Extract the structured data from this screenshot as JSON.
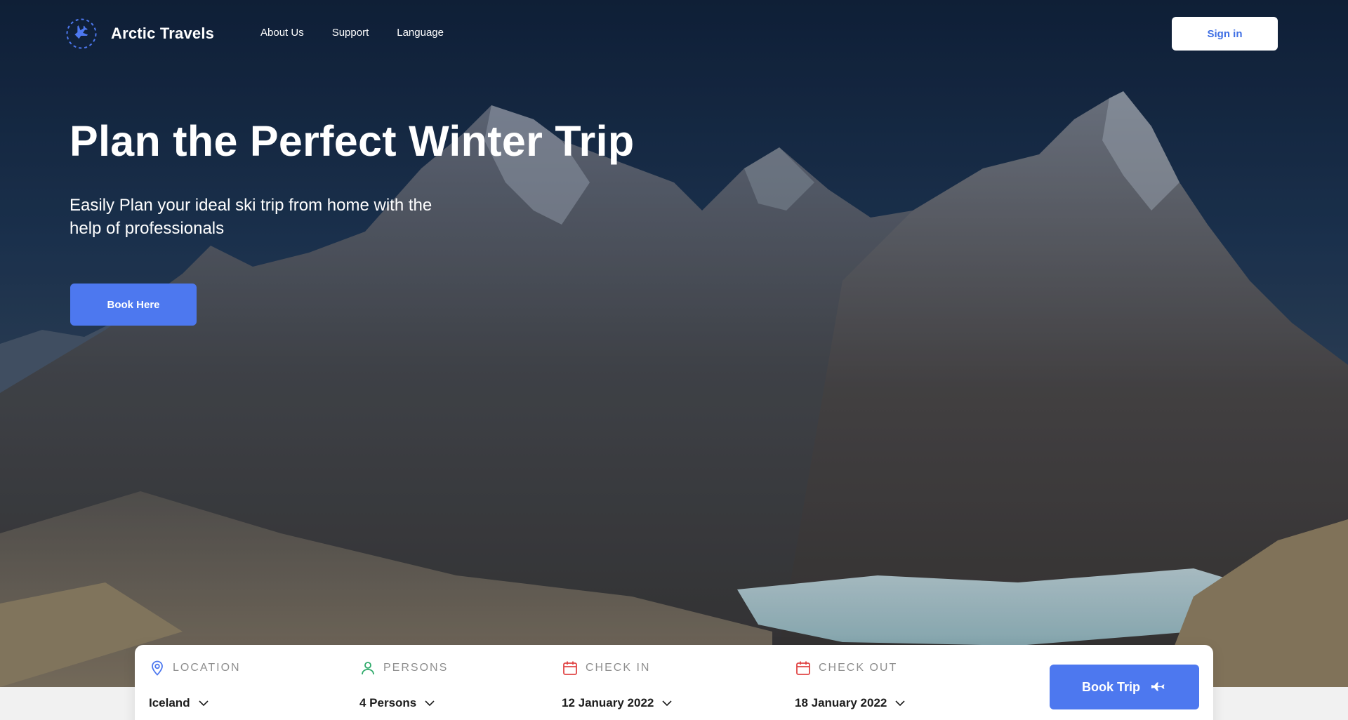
{
  "brand": {
    "name": "Arctic Travels",
    "icon": "plane-icon"
  },
  "nav": {
    "links": [
      "About Us",
      "Support",
      "Language"
    ],
    "sign_in": "Sign in"
  },
  "hero": {
    "title": "Plan the Perfect Winter Trip",
    "subtitle": "Easily Plan your ideal ski trip from home with the help of professionals",
    "cta": "Book Here",
    "background": "mountain-landscape"
  },
  "booking": {
    "location": {
      "label": "LOCATION",
      "value": "Iceland",
      "icon": "map-pin-icon"
    },
    "persons": {
      "label": "PERSONS",
      "value": "4 Persons",
      "icon": "user-icon"
    },
    "check_in": {
      "label": "CHECK IN",
      "value": "12 January 2022",
      "icon": "calendar-icon"
    },
    "check_out": {
      "label": "CHECK OUT",
      "value": "18 January 2022",
      "icon": "calendar-icon"
    },
    "submit": "Book Trip"
  },
  "colors": {
    "accent": "#4d78ef",
    "nav_bg": "#14213a",
    "panel_bg": "#ffffff",
    "location_icon": "#4d78ef",
    "persons_icon": "#2eaa6a",
    "calendar_icon": "#e04545"
  }
}
